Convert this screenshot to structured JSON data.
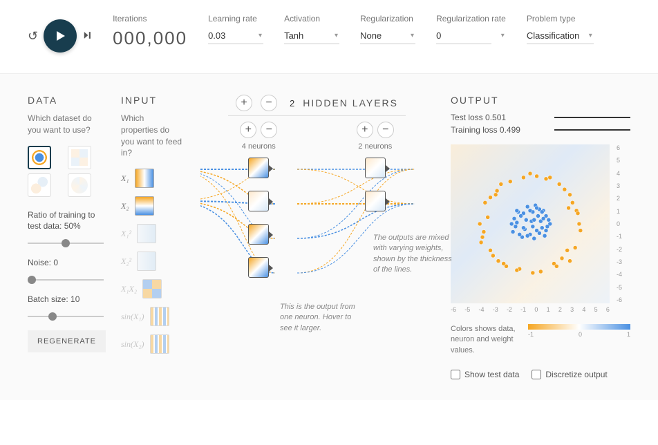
{
  "controls": {
    "iterations_label": "Iterations",
    "iterations_value": "000,000",
    "learning_rate_label": "Learning rate",
    "learning_rate_value": "0.03",
    "activation_label": "Activation",
    "activation_value": "Tanh",
    "regularization_label": "Regularization",
    "regularization_value": "None",
    "reg_rate_label": "Regularization rate",
    "reg_rate_value": "0",
    "problem_label": "Problem type",
    "problem_value": "Classification"
  },
  "data_panel": {
    "title": "DATA",
    "subtitle": "Which dataset do you want to use?",
    "ratio_label": "Ratio of training to test data:  50%",
    "ratio_value": 50,
    "noise_label": "Noise:  0",
    "noise_value": 0,
    "batch_label": "Batch size:  10",
    "batch_value": 10,
    "regen_label": "REGENERATE"
  },
  "input_panel": {
    "title": "INPUT",
    "subtitle": "Which properties do you want to feed in?",
    "x1": "X₁",
    "x2": "X₂",
    "x1sq": "X₁²",
    "x2sq": "X₂²",
    "x1x2": "X₁X₂",
    "sinx1": "sin(X₁)",
    "sinx2": "sin(X₂)"
  },
  "network": {
    "count": "2",
    "title": "HIDDEN LAYERS",
    "layer1_count": "4 neurons",
    "layer2_count": "2 neurons",
    "annotation_neuron": "This is the output from one neuron. Hover to see it larger.",
    "annotation_weights": "The outputs are mixed with varying weights, shown by the thickness of the lines."
  },
  "output": {
    "title": "OUTPUT",
    "test_loss": "Test loss 0.501",
    "train_loss": "Training loss 0.499",
    "legend_txt": "Colors shows data, neuron and weight values.",
    "grad_min": "-1",
    "grad_mid": "0",
    "grad_max": "1",
    "show_test": "Show test data",
    "discretize": "Discretize output",
    "y_ticks": [
      "6",
      "5",
      "4",
      "3",
      "2",
      "1",
      "0",
      "-1",
      "-2",
      "-3",
      "-4",
      "-5",
      "-6"
    ],
    "x_ticks": [
      "-6",
      "-5",
      "-4",
      "-3",
      "-2",
      "-1",
      "0",
      "1",
      "2",
      "3",
      "4",
      "5",
      "6"
    ]
  },
  "chart_data": {
    "type": "scatter",
    "title": "",
    "xlabel": "",
    "ylabel": "",
    "xlim": [
      -6,
      6
    ],
    "ylim": [
      -6,
      6
    ],
    "series": [
      {
        "name": "class_blue",
        "color": "#4a90e2",
        "points": [
          [
            0.1,
            0.2
          ],
          [
            -0.5,
            0.8
          ],
          [
            0.9,
            -0.3
          ],
          [
            1.2,
            0.6
          ],
          [
            -1.0,
            0.1
          ],
          [
            0.3,
            -1.1
          ],
          [
            -0.2,
            1.3
          ],
          [
            1.5,
            0.0
          ],
          [
            -1.3,
            -0.6
          ],
          [
            0.7,
            1.1
          ],
          [
            0.0,
            -0.8
          ],
          [
            -0.9,
            0.9
          ],
          [
            1.0,
            1.0
          ],
          [
            -1.2,
            0.4
          ],
          [
            0.5,
            -0.5
          ],
          [
            0.2,
            0.9
          ],
          [
            -0.6,
            -1.0
          ],
          [
            1.3,
            -0.2
          ],
          [
            -0.3,
            0.3
          ],
          [
            0.8,
            0.2
          ],
          [
            -1.1,
            -0.2
          ],
          [
            0.4,
            1.4
          ],
          [
            1.1,
            -0.9
          ],
          [
            -0.7,
            0.6
          ],
          [
            0.6,
            0.6
          ],
          [
            -0.4,
            -0.4
          ],
          [
            1.4,
            0.3
          ],
          [
            -1.4,
            0.0
          ],
          [
            0.0,
            1.0
          ],
          [
            0.9,
            0.9
          ],
          [
            -0.8,
            -0.8
          ],
          [
            1.2,
            -0.5
          ],
          [
            -0.5,
            -0.3
          ],
          [
            0.3,
            0.3
          ],
          [
            0.7,
            -0.7
          ],
          [
            -0.2,
            -0.9
          ],
          [
            1.0,
            0.4
          ],
          [
            -1.0,
            1.0
          ],
          [
            0.2,
            -0.2
          ],
          [
            0.5,
            1.2
          ]
        ]
      },
      {
        "name": "class_orange",
        "color": "#f5a623",
        "points": [
          [
            3.5,
            1.0
          ],
          [
            -3.2,
            0.5
          ],
          [
            2.8,
            -2.0
          ],
          [
            -2.5,
            2.5
          ],
          [
            0.5,
            3.6
          ],
          [
            -0.8,
            -3.4
          ],
          [
            3.0,
            2.2
          ],
          [
            -3.6,
            -1.0
          ],
          [
            1.8,
            -3.0
          ],
          [
            -1.5,
            3.2
          ],
          [
            3.8,
            -0.5
          ],
          [
            -3.0,
            -2.0
          ],
          [
            2.2,
            3.0
          ],
          [
            -2.0,
            -3.0
          ],
          [
            0.0,
            3.8
          ],
          [
            0.2,
            -3.7
          ],
          [
            3.4,
            -1.8
          ],
          [
            -3.4,
            1.6
          ],
          [
            2.6,
            2.6
          ],
          [
            -2.8,
            -2.4
          ],
          [
            3.6,
            0.8
          ],
          [
            -3.8,
            0.0
          ],
          [
            1.2,
            3.4
          ],
          [
            -1.0,
            -3.5
          ],
          [
            2.0,
            -3.2
          ],
          [
            -2.2,
            3.0
          ],
          [
            3.2,
            1.6
          ],
          [
            -3.5,
            -0.6
          ],
          [
            0.8,
            -3.6
          ],
          [
            -0.5,
            3.5
          ],
          [
            3.0,
            -2.8
          ],
          [
            -2.6,
            2.2
          ],
          [
            2.4,
            -2.6
          ],
          [
            -3.0,
            2.0
          ],
          [
            3.7,
            0.0
          ],
          [
            -3.7,
            -1.4
          ],
          [
            1.5,
            3.5
          ],
          [
            -1.8,
            -3.2
          ],
          [
            2.9,
            1.2
          ],
          [
            -2.4,
            -2.8
          ]
        ]
      }
    ]
  }
}
